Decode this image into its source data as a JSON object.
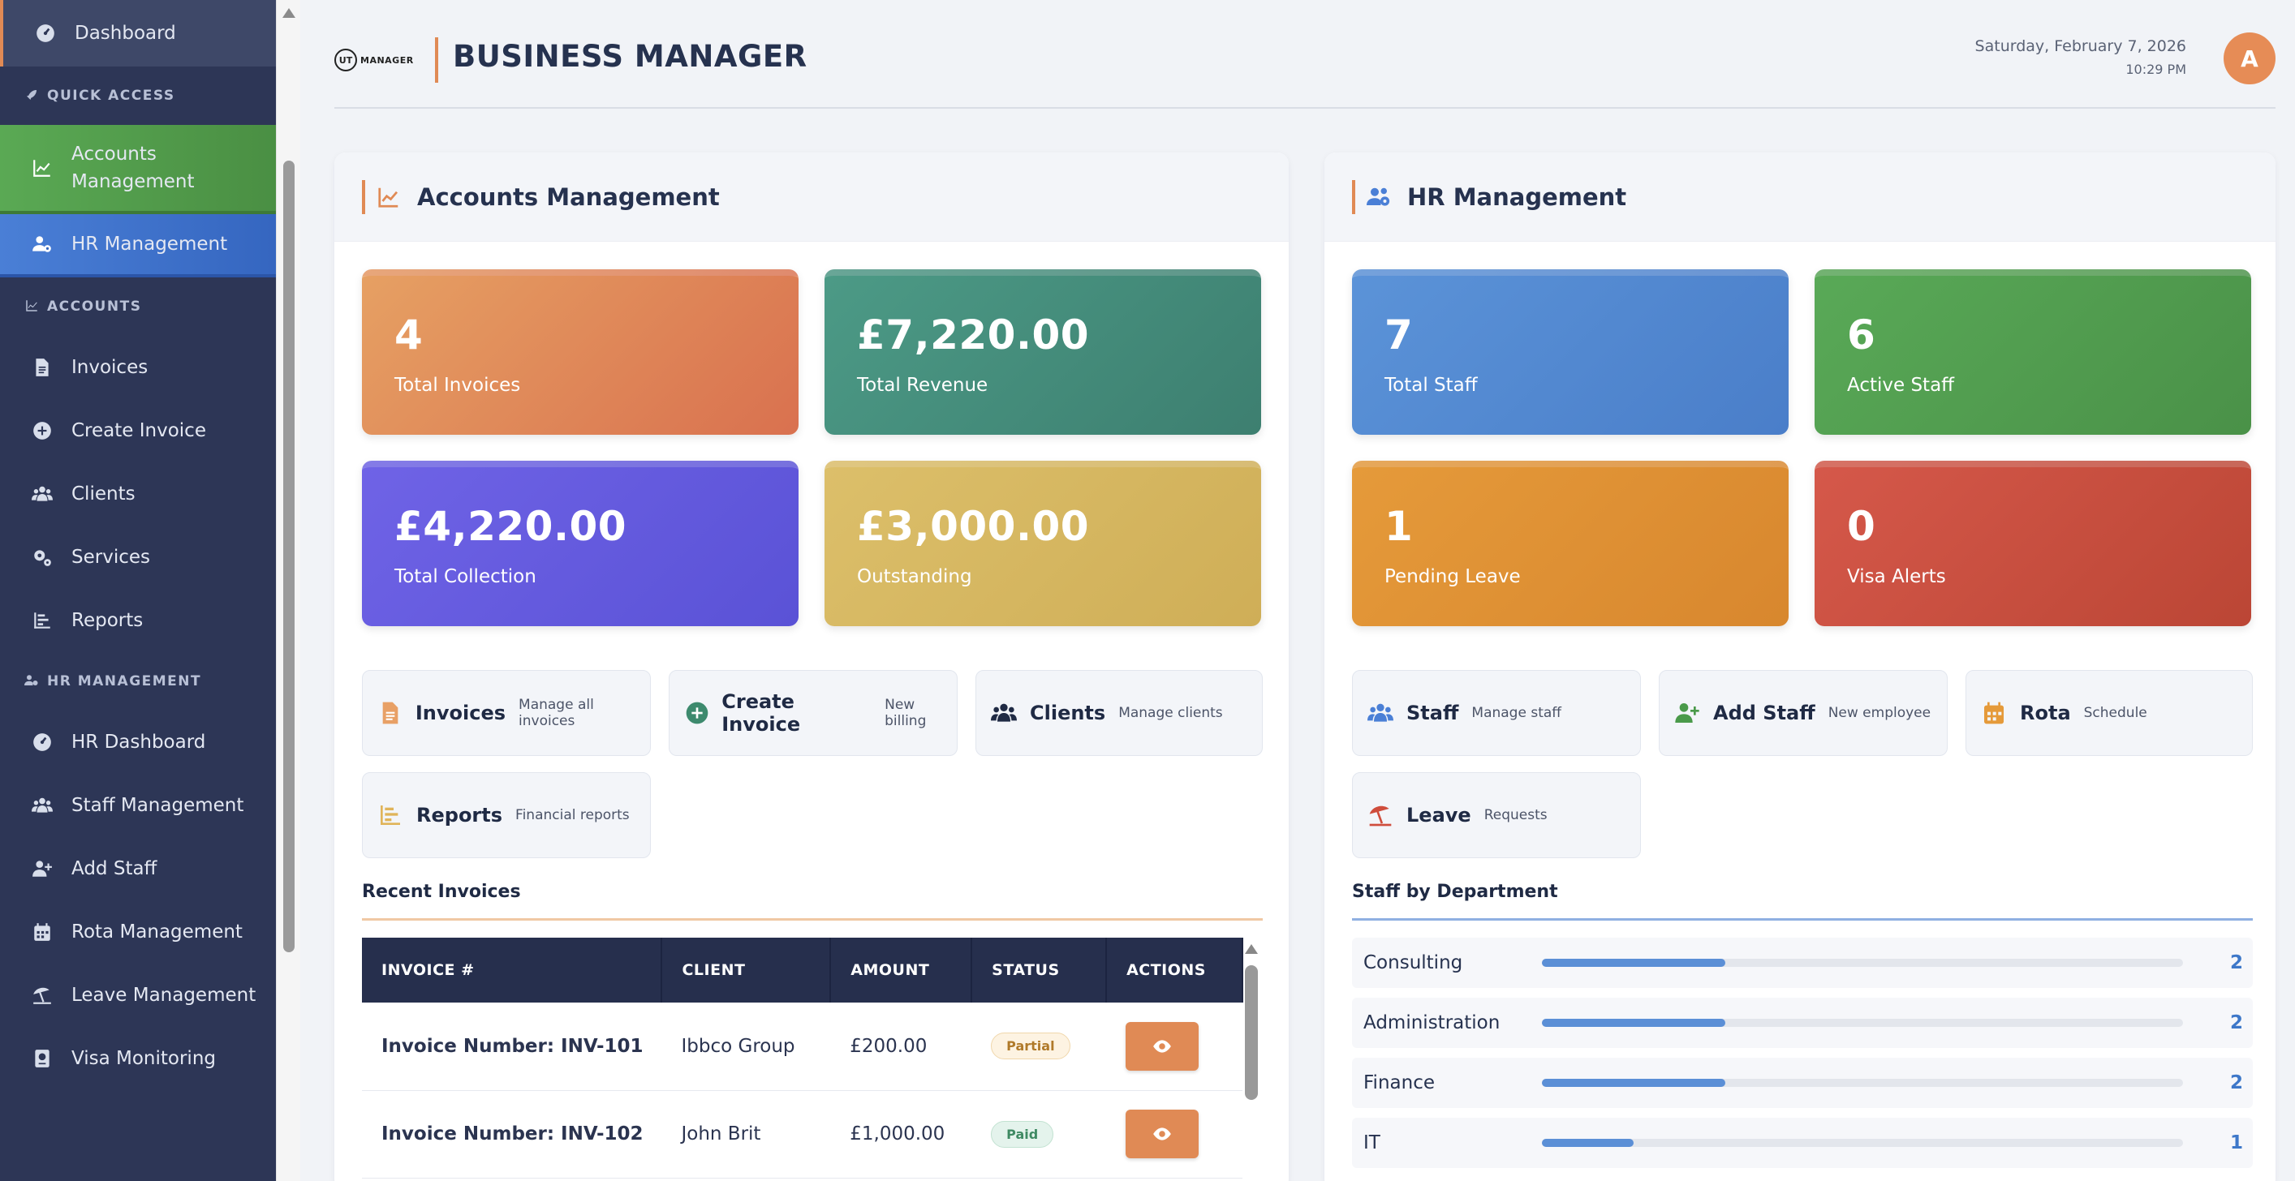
{
  "sidebar": {
    "dashboard": "Dashboard",
    "quick_access": "QUICK ACCESS",
    "accounts_mgmt": "Accounts Management",
    "hr_mgmt": "HR Management",
    "accounts_section": "ACCOUNTS",
    "invoices": "Invoices",
    "create_invoice": "Create Invoice",
    "clients": "Clients",
    "services": "Services",
    "reports": "Reports",
    "hr_section": "HR MANAGEMENT",
    "hr_dashboard": "HR Dashboard",
    "staff_mgmt": "Staff Management",
    "add_staff": "Add Staff",
    "rota_mgmt": "Rota Management",
    "leave_mgmt": "Leave Management",
    "visa_monitoring": "Visa Monitoring"
  },
  "header": {
    "logo_text": "MANAGER",
    "logo_mark": "UT",
    "title": "BUSINESS MANAGER",
    "date": "Saturday, February 7, 2026",
    "time": "10:29 PM",
    "avatar": "A"
  },
  "colors": {
    "accent": "#e08a55",
    "sidebar": "#2d3656",
    "accounts_green": "#5aa954",
    "hr_blue": "#4a7fd6"
  },
  "accounts": {
    "title": "Accounts Management",
    "stats": [
      {
        "value": "4",
        "label": "Total Invoices"
      },
      {
        "value": "£7,220.00",
        "label": "Total Revenue"
      },
      {
        "value": "£4,220.00",
        "label": "Total Collection"
      },
      {
        "value": "£3,000.00",
        "label": "Outstanding"
      }
    ],
    "quick": [
      {
        "title": "Invoices",
        "sub": "Manage all invoices",
        "icon": "file-invoice-icon"
      },
      {
        "title": "Create Invoice",
        "sub": "New billing",
        "icon": "plus-circle-icon"
      },
      {
        "title": "Clients",
        "sub": "Manage clients",
        "icon": "users-icon"
      },
      {
        "title": "Reports",
        "sub": "Financial reports",
        "icon": "chart-bar-icon"
      }
    ],
    "recent_title": "Recent Invoices",
    "table": {
      "headers": [
        "INVOICE #",
        "CLIENT",
        "AMOUNT",
        "STATUS",
        "ACTIONS"
      ],
      "rows": [
        {
          "invoice": "Invoice Number: INV-101",
          "client": "Ibbco Group",
          "amount": "£200.00",
          "status": "Partial"
        },
        {
          "invoice": "Invoice Number: INV-102",
          "client": "John Brit",
          "amount": "£1,000.00",
          "status": "Paid"
        }
      ]
    }
  },
  "hr": {
    "title": "HR Management",
    "stats": [
      {
        "value": "7",
        "label": "Total Staff"
      },
      {
        "value": "6",
        "label": "Active Staff"
      },
      {
        "value": "1",
        "label": "Pending Leave"
      },
      {
        "value": "0",
        "label": "Visa Alerts"
      }
    ],
    "quick": [
      {
        "title": "Staff",
        "sub": "Manage staff",
        "icon": "users-icon"
      },
      {
        "title": "Add Staff",
        "sub": "New employee",
        "icon": "user-plus-icon"
      },
      {
        "title": "Rota",
        "sub": "Schedule",
        "icon": "calendar-icon"
      },
      {
        "title": "Leave",
        "sub": "Requests",
        "icon": "umbrella-beach-icon"
      }
    ],
    "dept_title": "Staff by Department",
    "departments": [
      {
        "name": "Consulting",
        "count": "2",
        "fraction": 0.286
      },
      {
        "name": "Administration",
        "count": "2",
        "fraction": 0.286
      },
      {
        "name": "Finance",
        "count": "2",
        "fraction": 0.286
      },
      {
        "name": "IT",
        "count": "1",
        "fraction": 0.143
      }
    ]
  }
}
